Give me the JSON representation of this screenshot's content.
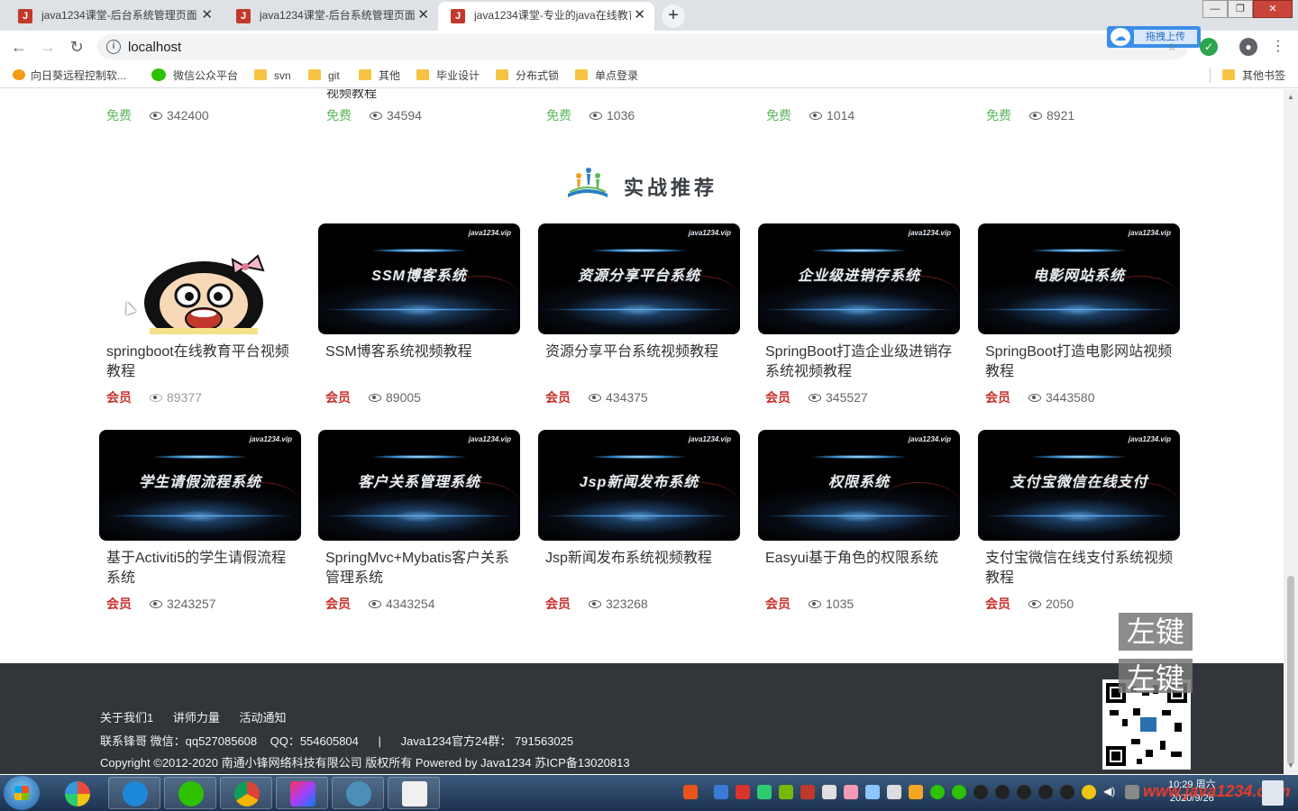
{
  "browser": {
    "tabs": [
      {
        "title": "java1234课堂-后台系统管理页面",
        "favicon": "J"
      },
      {
        "title": "java1234课堂-后台系统管理页面",
        "favicon": "J"
      },
      {
        "title": "java1234课堂-专业的java在线教育",
        "favicon": "J"
      }
    ],
    "new_tab": "+",
    "url": "localhost",
    "upload_button": "拖拽上传",
    "win_controls": {
      "minimize": "—",
      "restore": "❐",
      "close": "✕"
    }
  },
  "bookmarks": [
    {
      "label": "向日葵远程控制软...",
      "icon": "sunflower-icon"
    },
    {
      "label": "微信公众平台",
      "icon": "wechat-icon"
    },
    {
      "label": "svn",
      "icon": "folder-icon"
    },
    {
      "label": "git",
      "icon": "folder-icon"
    },
    {
      "label": "其他",
      "icon": "folder-icon"
    },
    {
      "label": "毕业设计",
      "icon": "folder-icon"
    },
    {
      "label": "分布式锁",
      "icon": "folder-icon"
    },
    {
      "label": "单点登录",
      "icon": "folder-icon"
    }
  ],
  "other_bookmarks": "其他书签",
  "top_row": {
    "cutoff_text": "视频教程",
    "items": [
      {
        "price": "免费",
        "views": "342400"
      },
      {
        "price": "免费",
        "views": "34594"
      },
      {
        "price": "免费",
        "views": "1036"
      },
      {
        "price": "免费",
        "views": "1014"
      },
      {
        "price": "免费",
        "views": "8921"
      }
    ]
  },
  "section": {
    "title": "实战推荐"
  },
  "courses": [
    {
      "thumb_title": "",
      "title": "springboot在线教育平台视频教程",
      "price": "会员",
      "views": "89377"
    },
    {
      "thumb_title": "SSM博客系统",
      "title": "SSM博客系统视频教程",
      "price": "会员",
      "views": "89005"
    },
    {
      "thumb_title": "资源分享平台系统",
      "title": "资源分享平台系统视频教程",
      "price": "会员",
      "views": "434375"
    },
    {
      "thumb_title": "企业级进销存系统",
      "title": "SpringBoot打造企业级进销存系统视频教程",
      "price": "会员",
      "views": "345527"
    },
    {
      "thumb_title": "电影网站系统",
      "title": "SpringBoot打造电影网站视频教程",
      "price": "会员",
      "views": "3443580"
    },
    {
      "thumb_title": "学生请假流程系统",
      "title": "基于Activiti5的学生请假流程系统",
      "price": "会员",
      "views": "3243257"
    },
    {
      "thumb_title": "客户关系管理系统",
      "title": "SpringMvc+Mybatis客户关系管理系统",
      "price": "会员",
      "views": "4343254"
    },
    {
      "thumb_title": "Jsp新闻发布系统",
      "title": "Jsp新闻发布系统视频教程",
      "price": "会员",
      "views": "323268"
    },
    {
      "thumb_title": "权限系统",
      "title": "Easyui基于角色的权限系统",
      "price": "会员",
      "views": "1035"
    },
    {
      "thumb_title": "支付宝微信在线支付",
      "title": "支付宝微信在线支付系统视频教程",
      "price": "会员",
      "views": "2050"
    }
  ],
  "thumb_brand": "java1234.vip",
  "footer": {
    "links": [
      "关于我们1",
      "讲师力量",
      "活动通知"
    ],
    "contact": "联系锋哥 微信：qq527085608    QQ：554605804      |      Java1234官方24群： 791563025",
    "copyright": "Copyright ©2012-2020 南通小锋网络科技有限公司 版权所有 Powered by Java1234 苏ICP备13020813"
  },
  "overlay_hint": [
    "左键",
    "左键"
  ],
  "taskbar": {
    "clock_time": "10:29 周六",
    "clock_date": "2020/9/26",
    "watermark": "www.java1234.com"
  },
  "colors": {
    "free": "#5cb85c",
    "vip": "#c9302c",
    "footer_bg": "#323539"
  }
}
